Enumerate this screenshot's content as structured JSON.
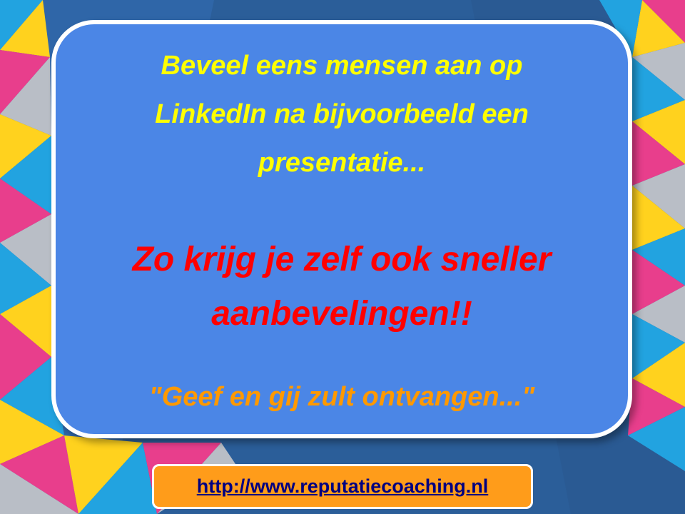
{
  "slide": {
    "intro_lines": [
      "Beveel eens mensen aan op",
      "LinkedIn na bijvoorbeeld een",
      "presentatie..."
    ],
    "highlight_lines": [
      "Zo krijg je zelf ook sneller",
      "aanbevelingen!!"
    ],
    "quote": "\"Geef en gij zult ontvangen...\""
  },
  "footer": {
    "link_text": "http://www.reputatiecoaching.nl",
    "link_href": "http://www.reputatiecoaching.nl"
  },
  "colors": {
    "background": "#2b5e99",
    "card": "#4b86e6",
    "intro_text": "#ffff00",
    "highlight_text": "#ff0000",
    "quote_text": "#ff9900",
    "link_box": "#ff9c1a",
    "link_text": "#000080",
    "accent_magenta": "#e83e8c",
    "accent_yellow": "#ffd21e",
    "accent_cyan": "#22a3e0",
    "accent_gray": "#b9bec6"
  }
}
